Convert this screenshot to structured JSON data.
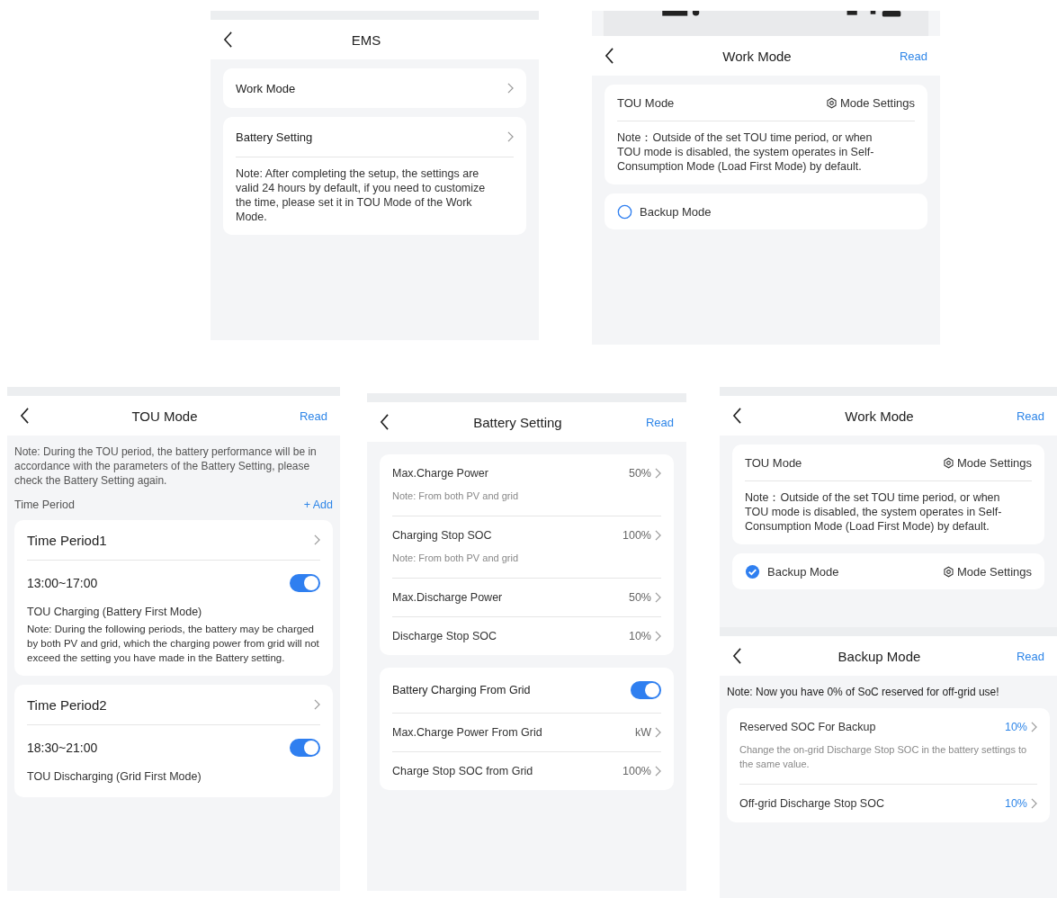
{
  "screens": [
    {
      "title": "EMS",
      "status_bar": false,
      "blocks": [
        {
          "kind": "card",
          "rows": [
            {
              "kind": "nav",
              "label": "Work Mode"
            }
          ]
        },
        {
          "kind": "card",
          "rows": [
            {
              "kind": "nav",
              "label": "Battery Setting"
            },
            {
              "kind": "note",
              "text": "Note: After completing the setup, the settings are valid 24 hours by default, if you need to customize the time, please set it in TOU Mode of the Work Mode."
            }
          ]
        }
      ]
    },
    {
      "title": "Work Mode",
      "action": "Read",
      "status_bar": true,
      "blocks": [
        {
          "kind": "card",
          "rows": [
            {
              "kind": "header",
              "label": "TOU Mode",
              "link": "Mode Settings"
            },
            {
              "kind": "note",
              "text": "Note：Outside of the set TOU time period, or when TOU mode is disabled, the system operates in Self-Consumption Mode (Load First Mode) by default."
            }
          ]
        },
        {
          "kind": "card",
          "rows": [
            {
              "kind": "radio",
              "label": "Backup Mode",
              "selected": false
            }
          ]
        }
      ]
    },
    {
      "title": "TOU Mode",
      "action": "Read",
      "status_bar": false,
      "blocks": [
        {
          "kind": "note",
          "text": "Note: During the TOU period, the battery performance will be in accordance with the parameters of the Battery Setting, please check the Battery Setting again."
        },
        {
          "kind": "section",
          "label": "Time Period",
          "action": "+ Add"
        },
        {
          "kind": "card",
          "rows": [
            {
              "kind": "nav",
              "label": "Time Period1"
            },
            {
              "kind": "toggle",
              "label": "13:00~17:00",
              "on": true
            },
            {
              "kind": "desc",
              "title": "TOU Charging (Battery First Mode)",
              "text": "Note: During the following periods, the battery may be charged by both PV and grid, which the charging power from grid will not exceed the setting you have made in the Battery setting."
            }
          ]
        },
        {
          "kind": "card",
          "rows": [
            {
              "kind": "nav",
              "label": "Time Period2"
            },
            {
              "kind": "toggle",
              "label": "18:30~21:00",
              "on": true
            },
            {
              "kind": "desc",
              "title": "TOU Discharging (Grid First Mode)"
            }
          ]
        }
      ]
    },
    {
      "title": "Battery Setting",
      "action": "Read",
      "status_bar": false,
      "blocks": [
        {
          "kind": "card",
          "rows": [
            {
              "kind": "value",
              "label": "Max.Charge Power",
              "value": "50%",
              "note": "Note: From both PV and grid"
            },
            {
              "kind": "value",
              "label": "Charging Stop SOC",
              "value": "100%",
              "note": "Note: From both PV and grid"
            },
            {
              "kind": "value",
              "label": "Max.Discharge Power",
              "value": "50%"
            },
            {
              "kind": "value",
              "label": "Discharge Stop SOC",
              "value": "10%"
            }
          ]
        },
        {
          "kind": "card",
          "rows": [
            {
              "kind": "toggle",
              "label": "Battery Charging From Grid",
              "on": true
            },
            {
              "kind": "value",
              "label": "Max.Charge Power From Grid",
              "value": "kW"
            },
            {
              "kind": "value",
              "label": "Charge Stop SOC from Grid",
              "value": "100%"
            }
          ]
        }
      ]
    },
    {
      "title": "Work Mode",
      "action": "Read",
      "status_bar": false,
      "blocks": [
        {
          "kind": "card",
          "rows": [
            {
              "kind": "header",
              "label": "TOU Mode",
              "link": "Mode Settings"
            },
            {
              "kind": "note",
              "text": "Note：Outside of the set TOU time period, or when TOU mode is disabled, the system operates in Self-Consumption Mode (Load First Mode) by default."
            }
          ]
        },
        {
          "kind": "card",
          "rows": [
            {
              "kind": "radio",
              "label": "Backup Mode",
              "selected": true,
              "link": "Mode Settings"
            }
          ]
        }
      ]
    },
    {
      "title": "Backup Mode",
      "action": "Read",
      "status_bar": false,
      "blocks": [
        {
          "kind": "note",
          "text": "Note: Now you have 0% of SoC reserved for off-grid use!"
        },
        {
          "kind": "card",
          "rows": [
            {
              "kind": "value",
              "label": "Reserved SOC For Backup",
              "value": "10%",
              "highlight": true,
              "note": "Change the on-grid Discharge Stop SOC in the battery settings to the same value."
            },
            {
              "kind": "value",
              "label": "Off-grid Discharge Stop SOC",
              "value": "10%",
              "highlight": true
            }
          ]
        }
      ]
    }
  ]
}
